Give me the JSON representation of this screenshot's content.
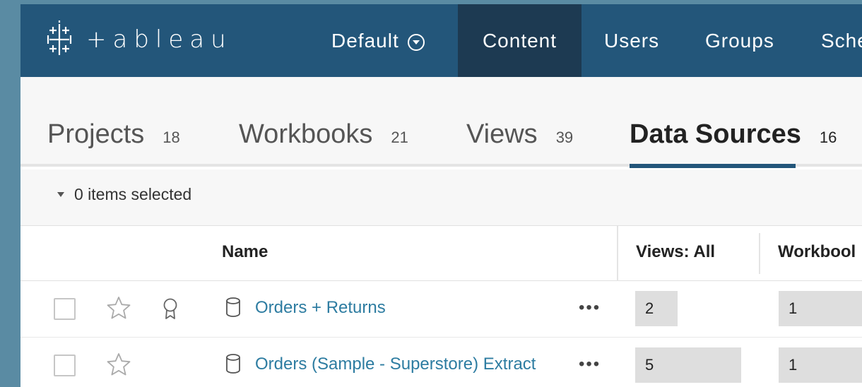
{
  "app": {
    "logo_text": "+ableau",
    "colors": {
      "nav_bg": "#23567a",
      "nav_active_bg": "#1d3a52",
      "link": "#2d7ca1",
      "tab_underline": "#23567a"
    }
  },
  "nav": {
    "site_label": "Default",
    "site_icon": "chevron-circle-down-icon",
    "items": [
      {
        "label": "Content",
        "active": true
      },
      {
        "label": "Users",
        "active": false
      },
      {
        "label": "Groups",
        "active": false
      },
      {
        "label": "Sche",
        "active": false
      }
    ]
  },
  "tabs": [
    {
      "label": "Projects",
      "count": "18",
      "active": false
    },
    {
      "label": "Workbooks",
      "count": "21",
      "active": false
    },
    {
      "label": "Views",
      "count": "39",
      "active": false
    },
    {
      "label": "Data Sources",
      "count": "16",
      "active": true
    }
  ],
  "selection": {
    "text": "0 items selected"
  },
  "table": {
    "columns": [
      "Name",
      "Views: All",
      "Workbool"
    ],
    "rows": [
      {
        "name": "Orders + Returns",
        "views": "2",
        "workbooks": "1",
        "views_fill": 0.4,
        "certified_icon": true
      },
      {
        "name": "Orders (Sample - Superstore) Extract",
        "views": "5",
        "workbooks": "1",
        "views_fill": 1.0,
        "certified_icon": false
      }
    ],
    "more_label": "•••"
  }
}
